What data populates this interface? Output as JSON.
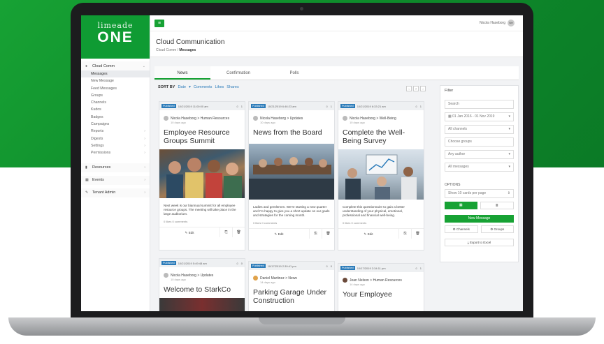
{
  "app": {
    "logo_line1": "limeade",
    "logo_line2": "ONE",
    "user_name": "Nicola Haseborg",
    "user_initials": "NH"
  },
  "sidebar": {
    "section_cloud": "Cloud Comm",
    "items": [
      "Messages",
      "New Message",
      "Feed Messages",
      "Groups",
      "Channels",
      "Kudos",
      "Badges",
      "Campaigns",
      "Reports",
      "Digests",
      "Settings",
      "Permissions"
    ],
    "resources": "Resources",
    "events": "Events",
    "tenant_admin": "Tenant Admin"
  },
  "header": {
    "title": "Cloud Communication",
    "crumb_root": "Cloud Comm",
    "crumb_current": "Messages"
  },
  "tabs": [
    "News",
    "Confirmation",
    "Polls"
  ],
  "sort": {
    "label": "SORT BY",
    "options": [
      "Date",
      "Comments",
      "Likes",
      "Shares"
    ]
  },
  "cards": [
    {
      "status": "Published",
      "date": "10/21/2019 11:00:00 am",
      "likes": "1",
      "author": "Nicola Haseborg > Human Resources",
      "ago": "10 days ago",
      "title": "Employee Resource Groups Summit",
      "body": "Next week is our biannual summit for all employee resource groups. The meeting will take place in the large auditorium.",
      "stats": "0 likes   0 comments",
      "edit": "Edit"
    },
    {
      "status": "Published",
      "date": "10/21/2019 6:46:23 am",
      "likes": "1",
      "author": "Nicola Haseborg > Updates",
      "ago": "10 days ago",
      "title": "News from the Board",
      "body": "Ladies and gentlemen. We're starting a new quarter and I'm happy to give you a short update on our goals and strategies for the coming month.",
      "stats": "0 likes   0 comments",
      "edit": "Edit"
    },
    {
      "status": "Published",
      "date": "10/21/2019 6:33:21 am",
      "likes": "1",
      "author": "Nicola Haseborg > Well-Being",
      "ago": "10 days ago",
      "title": "Complete the Well-Being Survey",
      "body": "Complete this questionnaire to gain a better understanding of your physical, emotional, professional and financial well-being.",
      "stats": "0 likes   0 comments",
      "edit": "Edit"
    },
    {
      "status": "Published",
      "date": "10/21/2019 5:49:48 am",
      "likes": "0",
      "author": "Nicola Haseborg > Updates",
      "ago": "10 days ago",
      "title": "Welcome to StarkCo"
    },
    {
      "status": "Published",
      "date": "10/17/2019 2:39:41 pm",
      "likes": "0",
      "author": "Daniel Martinez > News",
      "ago": "14 days ago",
      "title": "Parking Garage Under Construction"
    },
    {
      "status": "Published",
      "date": "10/17/2019 2:34:11 pm",
      "likes": "1",
      "author": "Jean Nelson > Human Resources",
      "ago": "14 days ago",
      "title": "Your Employee"
    }
  ],
  "filter": {
    "title": "Filter",
    "search_placeholder": "Search",
    "date_range": "01 Jan 2016 - 01 Nov 2019",
    "channels": "All channels",
    "groups": "Choose groups",
    "author": "Any author",
    "messages": "All messages",
    "options_label": "OPTIONS",
    "per_page": "Show 10 cards per page",
    "new_message": "New Message",
    "channels_btn": "Channels",
    "groups_btn": "Groups",
    "export": "Export to Excel"
  }
}
